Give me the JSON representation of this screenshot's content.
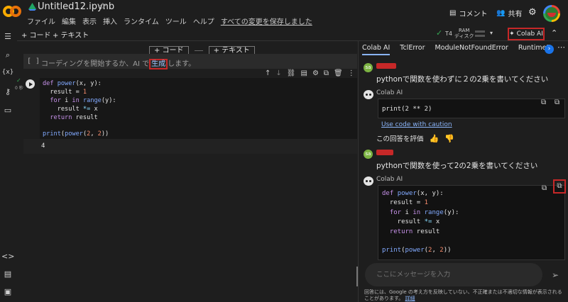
{
  "app": {
    "title": "Untitled12.ipynb",
    "saved_status": "すべての変更を保存しました"
  },
  "menu": [
    "ファイル",
    "編集",
    "表示",
    "挿入",
    "ランタイム",
    "ツール",
    "ヘルプ"
  ],
  "header": {
    "comment_label": "コメント",
    "share_label": "共有"
  },
  "toolbar": {
    "add_code": "+ コード",
    "add_text": "+ テキスト",
    "runtime_type": "T4",
    "ram_label": "RAM",
    "disk_label": "ディスク",
    "colab_ai_label": "Colab AI"
  },
  "insert": {
    "code": "+ コード",
    "text": "+ テキスト"
  },
  "empty_cell": {
    "bracket": "[ ]",
    "hint_before": "コーディングを開始するか、AI で",
    "generate_link": "生成",
    "hint_after": "します。"
  },
  "code_cell": {
    "lines": [
      [
        "def ",
        "power",
        "(x, y):"
      ],
      [
        "  result = ",
        "1",
        ""
      ],
      [
        "  ",
        "for",
        " i ",
        "in",
        " ",
        "range",
        "(y):"
      ],
      [
        "    result ",
        "*=",
        " x"
      ],
      [
        "  ",
        "return",
        " result"
      ],
      [
        ""
      ],
      [
        "print",
        "(",
        "power",
        "(",
        "2",
        ", ",
        "2",
        "))"
      ]
    ],
    "exec_time": "0 秒",
    "output": "4"
  },
  "panel": {
    "tabs": [
      "Colab AI",
      "TclError",
      "ModuleNotFoundError",
      "RuntimeE"
    ],
    "user_initials": "sa",
    "msg1": "pythonで関数を使わずに２の2乗を書いてください",
    "ai_name": "Colab AI",
    "answer1_code": "print(2 ** 2)",
    "caution_link": "Use code with caution",
    "rate_label": "この回答を評価",
    "msg2": "pythonで関数を使って2の2乗を書いてください",
    "answer2_lines": [
      [
        "def ",
        "power",
        "(x, y):"
      ],
      [
        "  result = ",
        "1",
        ""
      ],
      [
        "  ",
        "for",
        " i ",
        "in",
        " ",
        "range",
        "(y):"
      ],
      [
        "    result ",
        "*=",
        " x"
      ],
      [
        "  ",
        "return",
        " result"
      ],
      [
        ""
      ],
      [
        "print",
        "(",
        "power",
        "(",
        "2",
        ", ",
        "2",
        "))"
      ]
    ],
    "input_placeholder": "ここにメッセージを入力",
    "disclaimer_text": "回答には、Google の考え方を反映していない、不正確または不適切な情報が表示されることがあります。",
    "disclaimer_link": "詳細"
  },
  "colors": {
    "accent": "#8ab4f8",
    "highlight": "#c62828",
    "check": "#34a853"
  }
}
